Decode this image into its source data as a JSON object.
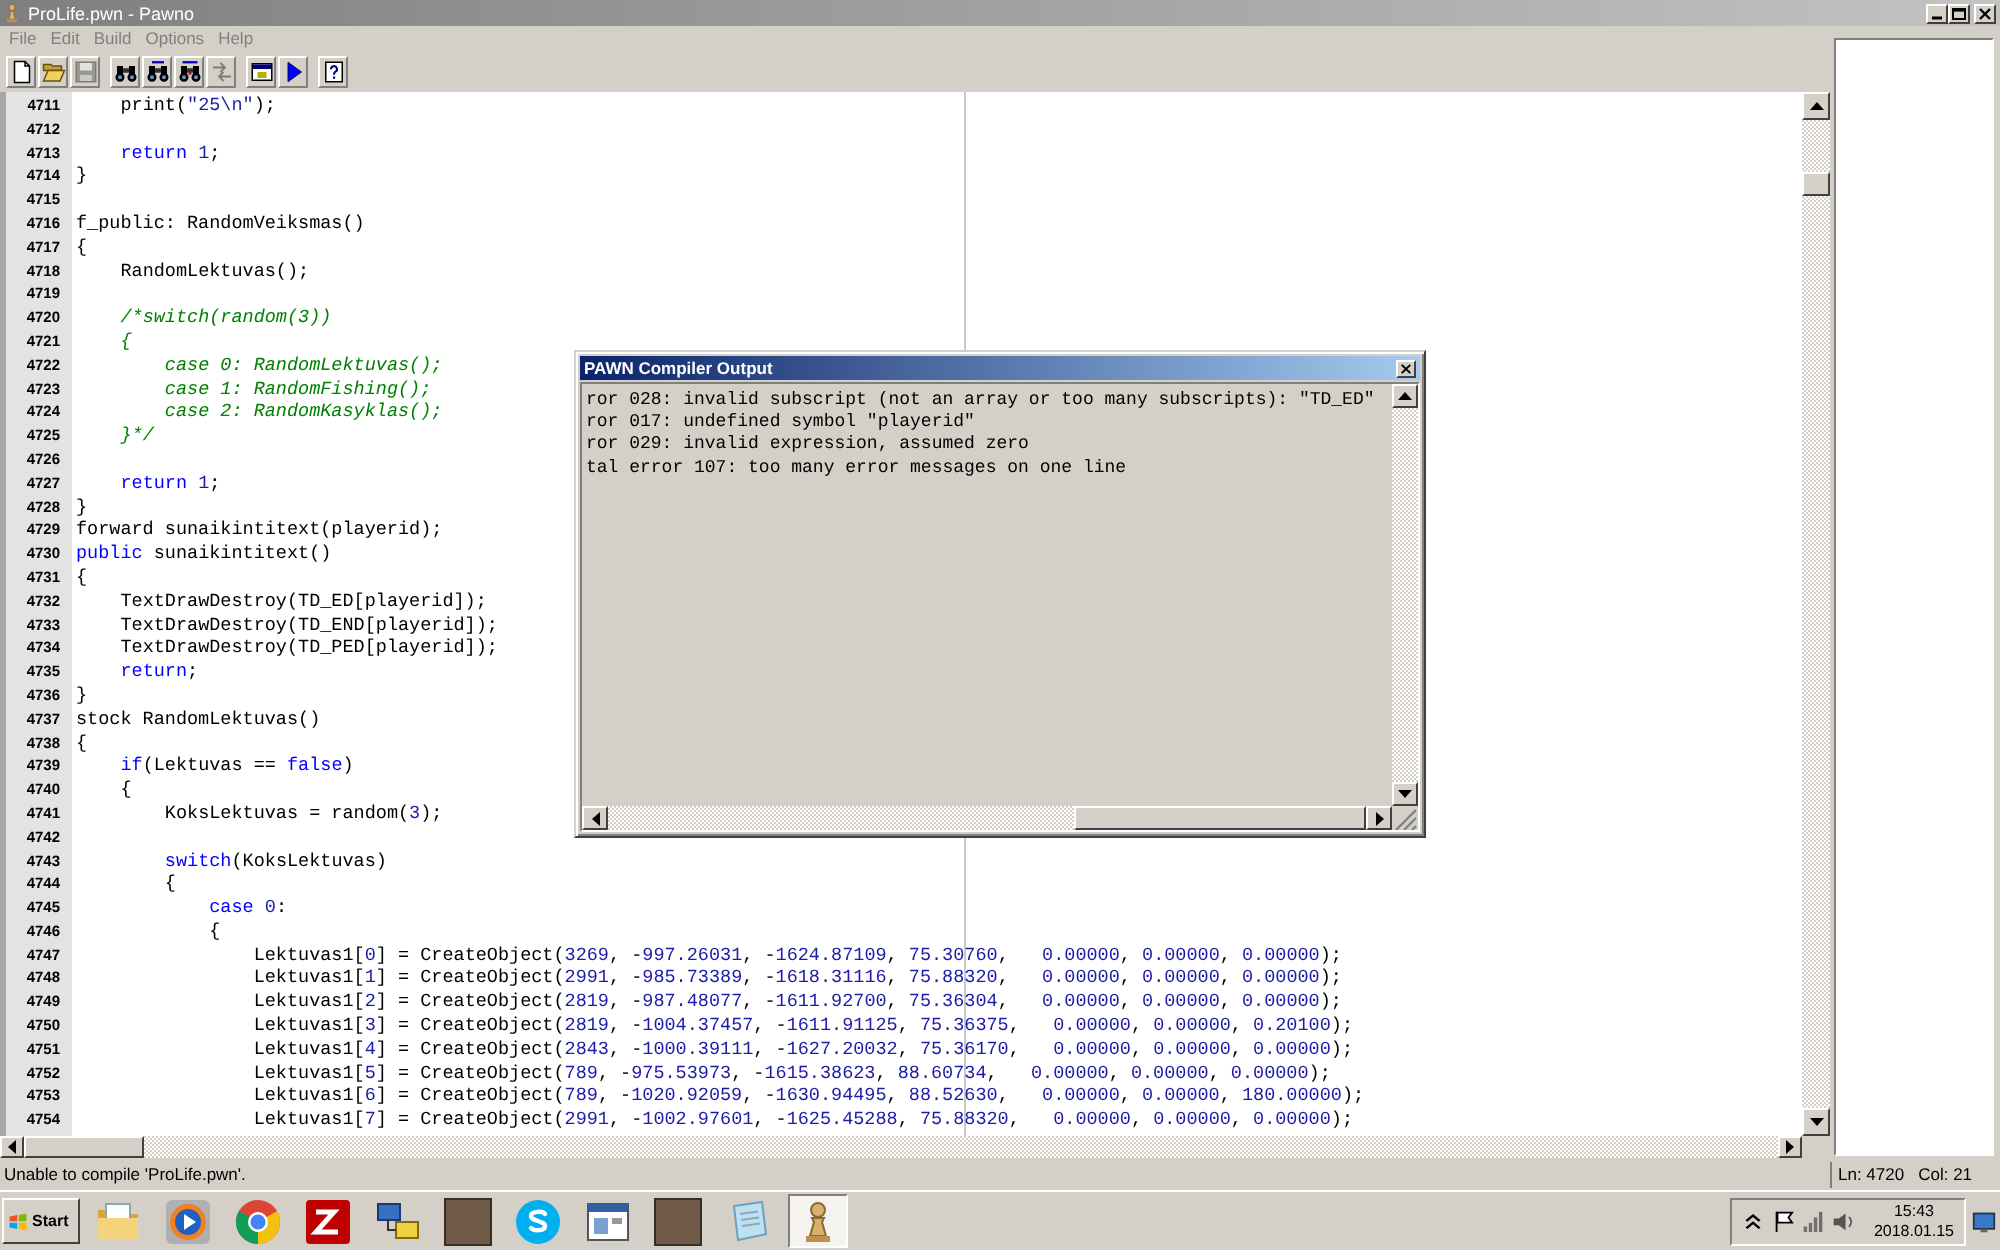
{
  "window": {
    "title": "ProLife.pwn - Pawno"
  },
  "menu": [
    "File",
    "Edit",
    "Build",
    "Options",
    "Help"
  ],
  "toolbar": [
    {
      "buttons": [
        {
          "kind": "page",
          "disabled": false
        },
        {
          "kind": "folder",
          "disabled": false
        },
        {
          "kind": "floppy",
          "disabled": true
        }
      ]
    },
    {
      "buttons": [
        {
          "kind": "binoculars",
          "disabled": false
        },
        {
          "kind": "binoculars-arrow",
          "disabled": false
        },
        {
          "kind": "binoculars-swap",
          "disabled": false
        },
        {
          "kind": "letters-swap",
          "disabled": true
        }
      ]
    },
    {
      "buttons": [
        {
          "kind": "window",
          "disabled": false
        },
        {
          "kind": "play",
          "disabled": false
        }
      ]
    },
    {
      "buttons": [
        {
          "kind": "help",
          "disabled": false
        }
      ]
    }
  ],
  "editor": {
    "lines": [
      {
        "number": "4711",
        "segments": [
          {
            "kind": "plain",
            "text": "    print("
          },
          {
            "kind": "string",
            "text": "\"25\\n\""
          },
          {
            "kind": "plain",
            "text": ");"
          }
        ]
      },
      {
        "number": "4712"
      },
      {
        "number": "4713",
        "segments": [
          {
            "kind": "keyword",
            "text": "    return"
          },
          {
            "kind": "number",
            "text": " 1"
          },
          {
            "kind": "plain",
            "text": ";"
          }
        ]
      },
      {
        "number": "4714",
        "segments": [
          {
            "kind": "plain",
            "text": "}"
          }
        ]
      },
      {
        "number": "4715"
      },
      {
        "number": "4716",
        "segments": [
          {
            "kind": "plain",
            "text": "f_public: RandomVeiksmas()"
          }
        ]
      },
      {
        "number": "4717",
        "segments": [
          {
            "kind": "plain",
            "text": "{"
          }
        ]
      },
      {
        "number": "4718",
        "segments": [
          {
            "kind": "plain",
            "text": "    RandomLektuvas();"
          }
        ]
      },
      {
        "number": "4719"
      },
      {
        "number": "4720",
        "segments": [
          {
            "kind": "comment",
            "text": "    /*switch(random(3))"
          }
        ]
      },
      {
        "number": "4721",
        "segments": [
          {
            "kind": "comment",
            "text": "    {"
          }
        ]
      },
      {
        "number": "4722",
        "segments": [
          {
            "kind": "comment",
            "text": "        case 0: RandomLektuvas();"
          }
        ]
      },
      {
        "number": "4723",
        "segments": [
          {
            "kind": "comment",
            "text": "        case 1: RandomFishing();"
          }
        ]
      },
      {
        "number": "4724",
        "segments": [
          {
            "kind": "comment",
            "text": "        case 2: RandomKasyklas();"
          }
        ]
      },
      {
        "number": "4725",
        "segments": [
          {
            "kind": "comment",
            "text": "    }*/"
          }
        ]
      },
      {
        "number": "4726"
      },
      {
        "number": "4727",
        "segments": [
          {
            "kind": "keyword",
            "text": "    return"
          },
          {
            "kind": "number",
            "text": " 1"
          },
          {
            "kind": "plain",
            "text": ";"
          }
        ]
      },
      {
        "number": "4728",
        "segments": [
          {
            "kind": "plain",
            "text": "}"
          }
        ]
      },
      {
        "number": "4729",
        "segments": [
          {
            "kind": "plain",
            "text": "forward sunaikintitext(playerid);"
          }
        ]
      },
      {
        "number": "4730",
        "segments": [
          {
            "kind": "keyword",
            "text": "public"
          },
          {
            "kind": "plain",
            "text": " sunaikintitext()"
          }
        ]
      },
      {
        "number": "4731",
        "segments": [
          {
            "kind": "plain",
            "text": "{"
          }
        ]
      },
      {
        "number": "4732",
        "segments": [
          {
            "kind": "plain",
            "text": "    TextDrawDestroy(TD_ED[playerid]);"
          }
        ]
      },
      {
        "number": "4733",
        "segments": [
          {
            "kind": "plain",
            "text": "    TextDrawDestroy(TD_END[playerid]);"
          }
        ]
      },
      {
        "number": "4734",
        "segments": [
          {
            "kind": "plain",
            "text": "    TextDrawDestroy(TD_PED[playerid]);"
          }
        ]
      },
      {
        "number": "4735",
        "segments": [
          {
            "kind": "keyword",
            "text": "    return"
          },
          {
            "kind": "plain",
            "text": ";"
          }
        ]
      },
      {
        "number": "4736",
        "segments": [
          {
            "kind": "plain",
            "text": "}"
          }
        ]
      },
      {
        "number": "4737",
        "segments": [
          {
            "kind": "plain",
            "text": "stock RandomLektuvas()"
          }
        ]
      },
      {
        "number": "4738",
        "segments": [
          {
            "kind": "plain",
            "text": "{"
          }
        ]
      },
      {
        "number": "4739",
        "segments": [
          {
            "kind": "keyword",
            "text": "    if"
          },
          {
            "kind": "plain",
            "text": "(Lektuvas == "
          },
          {
            "kind": "keyword",
            "text": "false"
          },
          {
            "kind": "plain",
            "text": ")"
          }
        ]
      },
      {
        "number": "4740",
        "segments": [
          {
            "kind": "plain",
            "text": "    {"
          }
        ]
      },
      {
        "number": "4741",
        "segments": [
          {
            "kind": "plain",
            "text": "        KoksLektuvas = random("
          },
          {
            "kind": "number",
            "text": "3"
          },
          {
            "kind": "plain",
            "text": ");"
          }
        ]
      },
      {
        "number": "4742"
      },
      {
        "number": "4743",
        "segments": [
          {
            "kind": "keyword",
            "text": "        switch"
          },
          {
            "kind": "plain",
            "text": "(KoksLektuvas)"
          }
        ]
      },
      {
        "number": "4744",
        "segments": [
          {
            "kind": "plain",
            "text": "        {"
          }
        ]
      },
      {
        "number": "4745",
        "segments": [
          {
            "kind": "keyword",
            "text": "            case"
          },
          {
            "kind": "number",
            "text": " 0"
          },
          {
            "kind": "plain",
            "text": ":"
          }
        ]
      },
      {
        "number": "4746",
        "segments": [
          {
            "kind": "plain",
            "text": "            {"
          }
        ]
      },
      {
        "number": "4747",
        "segments": [
          {
            "kind": "plain",
            "text": "                Lektuvas1["
          },
          {
            "kind": "number",
            "text": "0"
          },
          {
            "kind": "plain",
            "text": "] = CreateObject("
          },
          {
            "kind": "number",
            "text": "3269"
          },
          {
            "kind": "plain",
            "text": ", -"
          },
          {
            "kind": "number",
            "text": "997.26031"
          },
          {
            "kind": "plain",
            "text": ", -"
          },
          {
            "kind": "number",
            "text": "1624.87109"
          },
          {
            "kind": "plain",
            "text": ", "
          },
          {
            "kind": "number",
            "text": "75.30760"
          },
          {
            "kind": "plain",
            "text": ",   "
          },
          {
            "kind": "number",
            "text": "0.00000"
          },
          {
            "kind": "plain",
            "text": ", "
          },
          {
            "kind": "number",
            "text": "0.00000"
          },
          {
            "kind": "plain",
            "text": ", "
          },
          {
            "kind": "number",
            "text": "0.00000"
          },
          {
            "kind": "plain",
            "text": ");"
          }
        ]
      },
      {
        "number": "4748",
        "segments": [
          {
            "kind": "plain",
            "text": "                Lektuvas1["
          },
          {
            "kind": "number",
            "text": "1"
          },
          {
            "kind": "plain",
            "text": "] = CreateObject("
          },
          {
            "kind": "number",
            "text": "2991"
          },
          {
            "kind": "plain",
            "text": ", -"
          },
          {
            "kind": "number",
            "text": "985.73389"
          },
          {
            "kind": "plain",
            "text": ", -"
          },
          {
            "kind": "number",
            "text": "1618.31116"
          },
          {
            "kind": "plain",
            "text": ", "
          },
          {
            "kind": "number",
            "text": "75.88320"
          },
          {
            "kind": "plain",
            "text": ",   "
          },
          {
            "kind": "number",
            "text": "0.00000"
          },
          {
            "kind": "plain",
            "text": ", "
          },
          {
            "kind": "number",
            "text": "0.00000"
          },
          {
            "kind": "plain",
            "text": ", "
          },
          {
            "kind": "number",
            "text": "0.00000"
          },
          {
            "kind": "plain",
            "text": ");"
          }
        ]
      },
      {
        "number": "4749",
        "segments": [
          {
            "kind": "plain",
            "text": "                Lektuvas1["
          },
          {
            "kind": "number",
            "text": "2"
          },
          {
            "kind": "plain",
            "text": "] = CreateObject("
          },
          {
            "kind": "number",
            "text": "2819"
          },
          {
            "kind": "plain",
            "text": ", -"
          },
          {
            "kind": "number",
            "text": "987.48077"
          },
          {
            "kind": "plain",
            "text": ", -"
          },
          {
            "kind": "number",
            "text": "1611.92700"
          },
          {
            "kind": "plain",
            "text": ", "
          },
          {
            "kind": "number",
            "text": "75.36304"
          },
          {
            "kind": "plain",
            "text": ",   "
          },
          {
            "kind": "number",
            "text": "0.00000"
          },
          {
            "kind": "plain",
            "text": ", "
          },
          {
            "kind": "number",
            "text": "0.00000"
          },
          {
            "kind": "plain",
            "text": ", "
          },
          {
            "kind": "number",
            "text": "0.00000"
          },
          {
            "kind": "plain",
            "text": ");"
          }
        ]
      },
      {
        "number": "4750",
        "segments": [
          {
            "kind": "plain",
            "text": "                Lektuvas1["
          },
          {
            "kind": "number",
            "text": "3"
          },
          {
            "kind": "plain",
            "text": "] = CreateObject("
          },
          {
            "kind": "number",
            "text": "2819"
          },
          {
            "kind": "plain",
            "text": ", -"
          },
          {
            "kind": "number",
            "text": "1004.37457"
          },
          {
            "kind": "plain",
            "text": ", -"
          },
          {
            "kind": "number",
            "text": "1611.91125"
          },
          {
            "kind": "plain",
            "text": ", "
          },
          {
            "kind": "number",
            "text": "75.36375"
          },
          {
            "kind": "plain",
            "text": ",   "
          },
          {
            "kind": "number",
            "text": "0.00000"
          },
          {
            "kind": "plain",
            "text": ", "
          },
          {
            "kind": "number",
            "text": "0.00000"
          },
          {
            "kind": "plain",
            "text": ", "
          },
          {
            "kind": "number",
            "text": "0.20100"
          },
          {
            "kind": "plain",
            "text": ");"
          }
        ]
      },
      {
        "number": "4751",
        "segments": [
          {
            "kind": "plain",
            "text": "                Lektuvas1["
          },
          {
            "kind": "number",
            "text": "4"
          },
          {
            "kind": "plain",
            "text": "] = CreateObject("
          },
          {
            "kind": "number",
            "text": "2843"
          },
          {
            "kind": "plain",
            "text": ", -"
          },
          {
            "kind": "number",
            "text": "1000.39111"
          },
          {
            "kind": "plain",
            "text": ", -"
          },
          {
            "kind": "number",
            "text": "1627.20032"
          },
          {
            "kind": "plain",
            "text": ", "
          },
          {
            "kind": "number",
            "text": "75.36170"
          },
          {
            "kind": "plain",
            "text": ",   "
          },
          {
            "kind": "number",
            "text": "0.00000"
          },
          {
            "kind": "plain",
            "text": ", "
          },
          {
            "kind": "number",
            "text": "0.00000"
          },
          {
            "kind": "plain",
            "text": ", "
          },
          {
            "kind": "number",
            "text": "0.00000"
          },
          {
            "kind": "plain",
            "text": ");"
          }
        ]
      },
      {
        "number": "4752",
        "segments": [
          {
            "kind": "plain",
            "text": "                Lektuvas1["
          },
          {
            "kind": "number",
            "text": "5"
          },
          {
            "kind": "plain",
            "text": "] = CreateObject("
          },
          {
            "kind": "number",
            "text": "789"
          },
          {
            "kind": "plain",
            "text": ", -"
          },
          {
            "kind": "number",
            "text": "975.53973"
          },
          {
            "kind": "plain",
            "text": ", -"
          },
          {
            "kind": "number",
            "text": "1615.38623"
          },
          {
            "kind": "plain",
            "text": ", "
          },
          {
            "kind": "number",
            "text": "88.60734"
          },
          {
            "kind": "plain",
            "text": ",   "
          },
          {
            "kind": "number",
            "text": "0.00000"
          },
          {
            "kind": "plain",
            "text": ", "
          },
          {
            "kind": "number",
            "text": "0.00000"
          },
          {
            "kind": "plain",
            "text": ", "
          },
          {
            "kind": "number",
            "text": "0.00000"
          },
          {
            "kind": "plain",
            "text": ");"
          }
        ]
      },
      {
        "number": "4753",
        "segments": [
          {
            "kind": "plain",
            "text": "                Lektuvas1["
          },
          {
            "kind": "number",
            "text": "6"
          },
          {
            "kind": "plain",
            "text": "] = CreateObject("
          },
          {
            "kind": "number",
            "text": "789"
          },
          {
            "kind": "plain",
            "text": ", -"
          },
          {
            "kind": "number",
            "text": "1020.92059"
          },
          {
            "kind": "plain",
            "text": ", -"
          },
          {
            "kind": "number",
            "text": "1630.94495"
          },
          {
            "kind": "plain",
            "text": ", "
          },
          {
            "kind": "number",
            "text": "88.52630"
          },
          {
            "kind": "plain",
            "text": ",   "
          },
          {
            "kind": "number",
            "text": "0.00000"
          },
          {
            "kind": "plain",
            "text": ", "
          },
          {
            "kind": "number",
            "text": "0.00000"
          },
          {
            "kind": "plain",
            "text": ", "
          },
          {
            "kind": "number",
            "text": "180.00000"
          },
          {
            "kind": "plain",
            "text": ");"
          }
        ]
      },
      {
        "number": "4754",
        "segments": [
          {
            "kind": "plain",
            "text": "                Lektuvas1["
          },
          {
            "kind": "number",
            "text": "7"
          },
          {
            "kind": "plain",
            "text": "] = CreateObject("
          },
          {
            "kind": "number",
            "text": "2991"
          },
          {
            "kind": "plain",
            "text": ", -"
          },
          {
            "kind": "number",
            "text": "1002.97601"
          },
          {
            "kind": "plain",
            "text": ", -"
          },
          {
            "kind": "number",
            "text": "1625.45288"
          },
          {
            "kind": "plain",
            "text": ", "
          },
          {
            "kind": "number",
            "text": "75.88320"
          },
          {
            "kind": "plain",
            "text": ",   "
          },
          {
            "kind": "number",
            "text": "0.00000"
          },
          {
            "kind": "plain",
            "text": ", "
          },
          {
            "kind": "number",
            "text": "0.00000"
          },
          {
            "kind": "plain",
            "text": ", "
          },
          {
            "kind": "number",
            "text": "0.00000"
          },
          {
            "kind": "plain",
            "text": ");"
          }
        ]
      }
    ]
  },
  "compiler_output": {
    "title": "PAWN Compiler Output",
    "messages": [
      "ror 028: invalid subscript (not an array or too many subscripts): \"TD_ED\"",
      "ror 017: undefined symbol \"playerid\"",
      "ror 029: invalid expression, assumed zero",
      "tal error 107: too many error messages on one line"
    ]
  },
  "status_bar": {
    "message": "Unable to compile 'ProLife.pwn'.",
    "line": "Ln: 4720",
    "column": "Col: 21"
  },
  "taskbar": {
    "start": "Start",
    "apps": [
      {
        "kind": "folder",
        "selected": false
      },
      {
        "kind": "media",
        "selected": false
      },
      {
        "kind": "browser",
        "selected": false
      },
      {
        "kind": "ftp",
        "selected": false
      },
      {
        "kind": "network",
        "selected": false
      },
      {
        "kind": "photo",
        "selected": false
      },
      {
        "kind": "chat",
        "selected": false
      },
      {
        "kind": "window",
        "selected": false
      },
      {
        "kind": "photo",
        "selected": false
      },
      {
        "kind": "notepad",
        "selected": false
      },
      {
        "kind": "pawn",
        "selected": true
      }
    ],
    "clock": {
      "time": "15:43",
      "date": "2018.01.15"
    }
  }
}
